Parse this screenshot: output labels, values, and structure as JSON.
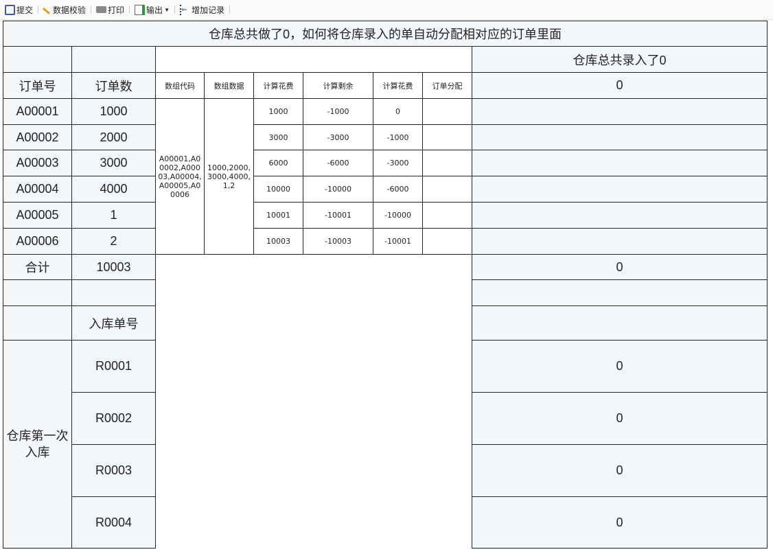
{
  "toolbar": {
    "submit": "提交",
    "validate": "数据校验",
    "print": "打印",
    "export": "输出",
    "add_record": "增加记录"
  },
  "title": "仓库总共做了0，如何将仓库录入的单自动分配相对应的订单里面",
  "right_header": "仓库总共录入了0",
  "headers": {
    "order_no": "订单号",
    "order_qty": "订单数",
    "array_code": "数组代码",
    "array_data": "数组数据",
    "calc_cost": "计算花费",
    "calc_remain": "计算剩余",
    "calc_cost2": "计算花费",
    "order_alloc": "订单分配",
    "right_value": "0"
  },
  "orders": [
    {
      "no": "A00001",
      "qty": "1000",
      "cost": "1000",
      "remain": "-1000",
      "cost2": "0"
    },
    {
      "no": "A00002",
      "qty": "2000",
      "cost": "3000",
      "remain": "-3000",
      "cost2": "-1000"
    },
    {
      "no": "A00003",
      "qty": "3000",
      "cost": "6000",
      "remain": "-6000",
      "cost2": "-3000"
    },
    {
      "no": "A00004",
      "qty": "4000",
      "cost": "10000",
      "remain": "-10000",
      "cost2": "-6000"
    },
    {
      "no": "A00005",
      "qty": "1",
      "cost": "10001",
      "remain": "-10001",
      "cost2": "-10000"
    },
    {
      "no": "A00006",
      "qty": "2",
      "cost": "10003",
      "remain": "-10003",
      "cost2": "-10001"
    }
  ],
  "array_code": "A00001,A00002,A00003,A00004,A00005,A00006",
  "array_data": "1000,2000,3000,4000,1,2",
  "total": {
    "label": "合计",
    "value": "10003",
    "right": "0"
  },
  "receipt": {
    "header": "入库单号",
    "group_label": "仓库第一次入库",
    "items": [
      {
        "no": "R0001",
        "value": "0"
      },
      {
        "no": "R0002",
        "value": "0"
      },
      {
        "no": "R0003",
        "value": "0"
      },
      {
        "no": "R0004",
        "value": "0"
      }
    ]
  }
}
